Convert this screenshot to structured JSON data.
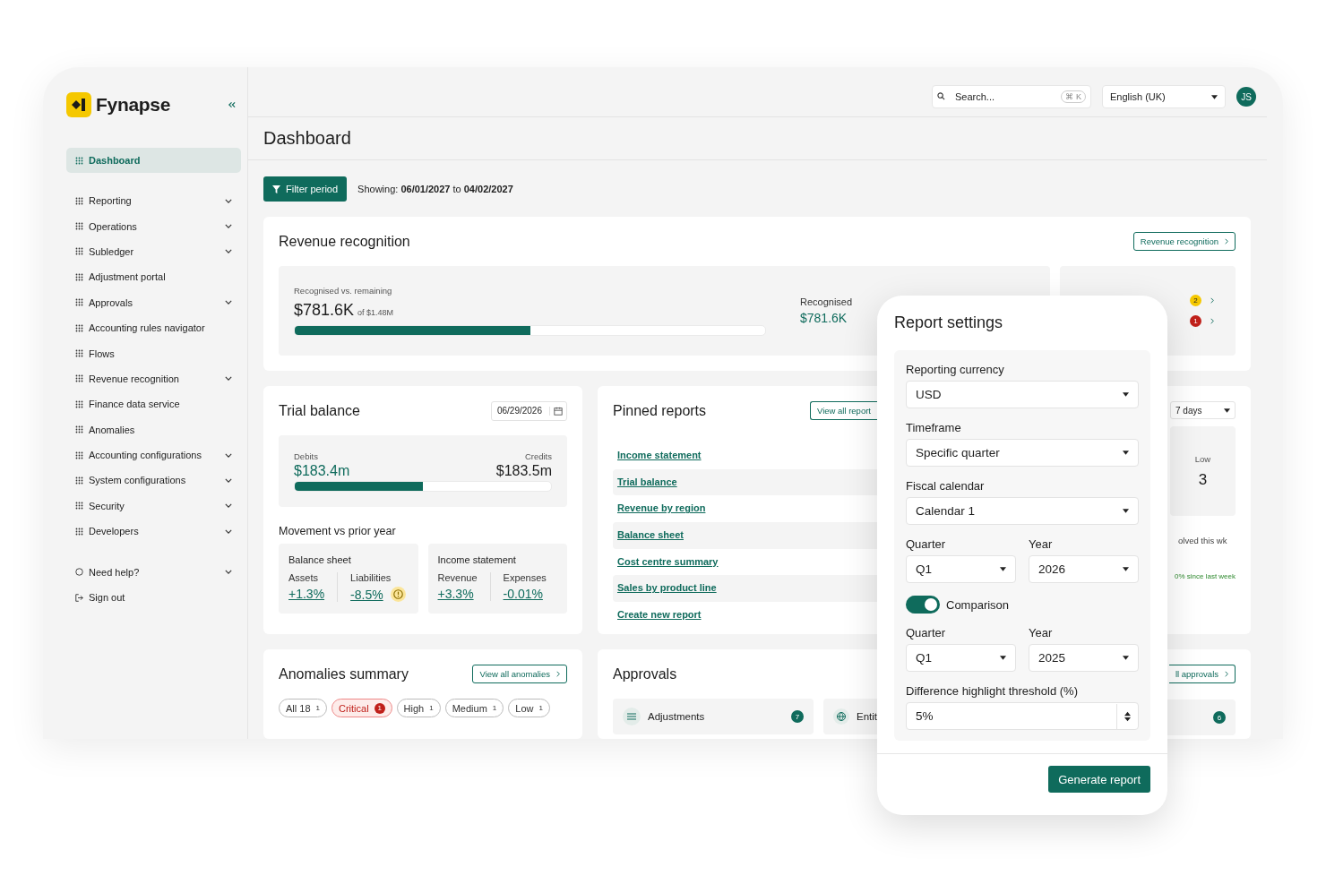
{
  "brand": {
    "name": "Fynapse"
  },
  "sidebar": {
    "items": [
      {
        "label": "Dashboard",
        "selected": true,
        "has_submenu": false
      },
      {
        "label": "Reporting",
        "selected": false,
        "has_submenu": true
      },
      {
        "label": "Operations",
        "selected": false,
        "has_submenu": true
      },
      {
        "label": "Subledger",
        "selected": false,
        "has_submenu": true
      },
      {
        "label": "Adjustment portal",
        "selected": false,
        "has_submenu": false
      },
      {
        "label": "Approvals",
        "selected": false,
        "has_submenu": true
      },
      {
        "label": "Accounting rules navigator",
        "selected": false,
        "has_submenu": false
      },
      {
        "label": "Flows",
        "selected": false,
        "has_submenu": false
      },
      {
        "label": "Revenue recognition",
        "selected": false,
        "has_submenu": true
      },
      {
        "label": "Finance data service",
        "selected": false,
        "has_submenu": false
      },
      {
        "label": "Anomalies",
        "selected": false,
        "has_submenu": false
      },
      {
        "label": "Accounting configurations",
        "selected": false,
        "has_submenu": true
      },
      {
        "label": "System configurations",
        "selected": false,
        "has_submenu": true
      },
      {
        "label": "Security",
        "selected": false,
        "has_submenu": true
      },
      {
        "label": "Developers",
        "selected": false,
        "has_submenu": true
      }
    ],
    "footer_items": [
      {
        "label": "Need help?",
        "selected": false,
        "has_submenu": true
      },
      {
        "label": "Sign out",
        "selected": false,
        "has_submenu": false
      }
    ]
  },
  "topbar": {
    "search": {
      "placeholder": "Search...",
      "shortcut": "⌘ K"
    },
    "language": "English (UK)",
    "avatar": "JS"
  },
  "page_title": "Dashboard",
  "filter": {
    "button": "Filter period",
    "showing_label": "Showing:",
    "from": "06/01/2027",
    "to_label": "to",
    "to": "04/02/2027"
  },
  "revenue_recognition": {
    "title": "Revenue recognition",
    "link": "Revenue recognition",
    "caption": "Recognised vs. remaining",
    "amount": "$781.6K",
    "of": "of $1.48M",
    "level": 0.5,
    "recognised_label": "Recognised",
    "recognised_value": "$781.6K",
    "side_badges": [
      {
        "count": "2",
        "color": "#f5c800"
      },
      {
        "count": "1",
        "color": "#c0201a"
      }
    ]
  },
  "trial_balance": {
    "title": "Trial balance",
    "date": "06/29/2026",
    "debits_label": "Debits",
    "debits": "$183.4m",
    "credits_label": "Credits",
    "credits": "$183.5m",
    "level": 0.5,
    "movement_title": "Movement vs prior year",
    "groups": [
      {
        "title": "Balance sheet",
        "metrics": [
          {
            "label": "Assets",
            "value": "+1.3%",
            "warning": false
          },
          {
            "label": "Liabilities",
            "value": "-8.5%",
            "warning": true
          }
        ]
      },
      {
        "title": "Income statement",
        "metrics": [
          {
            "label": "Revenue",
            "value": "+3.3%",
            "warning": false
          },
          {
            "label": "Expenses",
            "value": "-0.01%",
            "warning": false
          }
        ]
      }
    ]
  },
  "pinned_reports": {
    "title": "Pinned reports",
    "link": "View all report",
    "items": [
      "Income statement",
      "Trial balance",
      "Revenue by region",
      "Balance sheet",
      "Cost centre summary",
      "Sales by product line",
      "Create new report"
    ]
  },
  "right_card": {
    "range": "7 days",
    "low_label": "Low",
    "low_value": "3",
    "resolved": "olved this wk",
    "change": "0% since last week"
  },
  "anomalies": {
    "title": "Anomalies summary",
    "link": "View all anomalies",
    "filters": [
      {
        "label": "All 18",
        "count": "1",
        "selected": false
      },
      {
        "label": "Critical",
        "count": "1",
        "selected": true
      },
      {
        "label": "High",
        "count": "1",
        "selected": false
      },
      {
        "label": "Medium",
        "count": "1",
        "selected": false
      },
      {
        "label": "Low",
        "count": "1",
        "selected": false
      }
    ]
  },
  "approvals": {
    "title": "Approvals",
    "link": "ll approvals",
    "tiles": [
      {
        "label": "Adjustments",
        "count": "7"
      },
      {
        "label": "Entit"
      }
    ],
    "right_count": "6"
  },
  "report_settings": {
    "title": "Report settings",
    "button": "Generate report",
    "fields": [
      {
        "kind": "select",
        "label": "Reporting currency",
        "value": "USD"
      },
      {
        "kind": "select",
        "label": "Timeframe",
        "value": "Specific quarter"
      },
      {
        "kind": "select",
        "label": "Fiscal calendar",
        "value": "Calendar 1"
      },
      {
        "kind": "pair",
        "items": [
          {
            "label": "Quarter",
            "value": "Q1"
          },
          {
            "label": "Year",
            "value": "2026"
          }
        ]
      },
      {
        "kind": "toggle",
        "label": "Comparison",
        "on": true
      },
      {
        "kind": "pair",
        "items": [
          {
            "label": "Quarter",
            "value": "Q1"
          },
          {
            "label": "Year",
            "value": "2025"
          }
        ]
      },
      {
        "kind": "number",
        "label": "Difference highlight threshold (%)",
        "value": "5%"
      }
    ]
  }
}
